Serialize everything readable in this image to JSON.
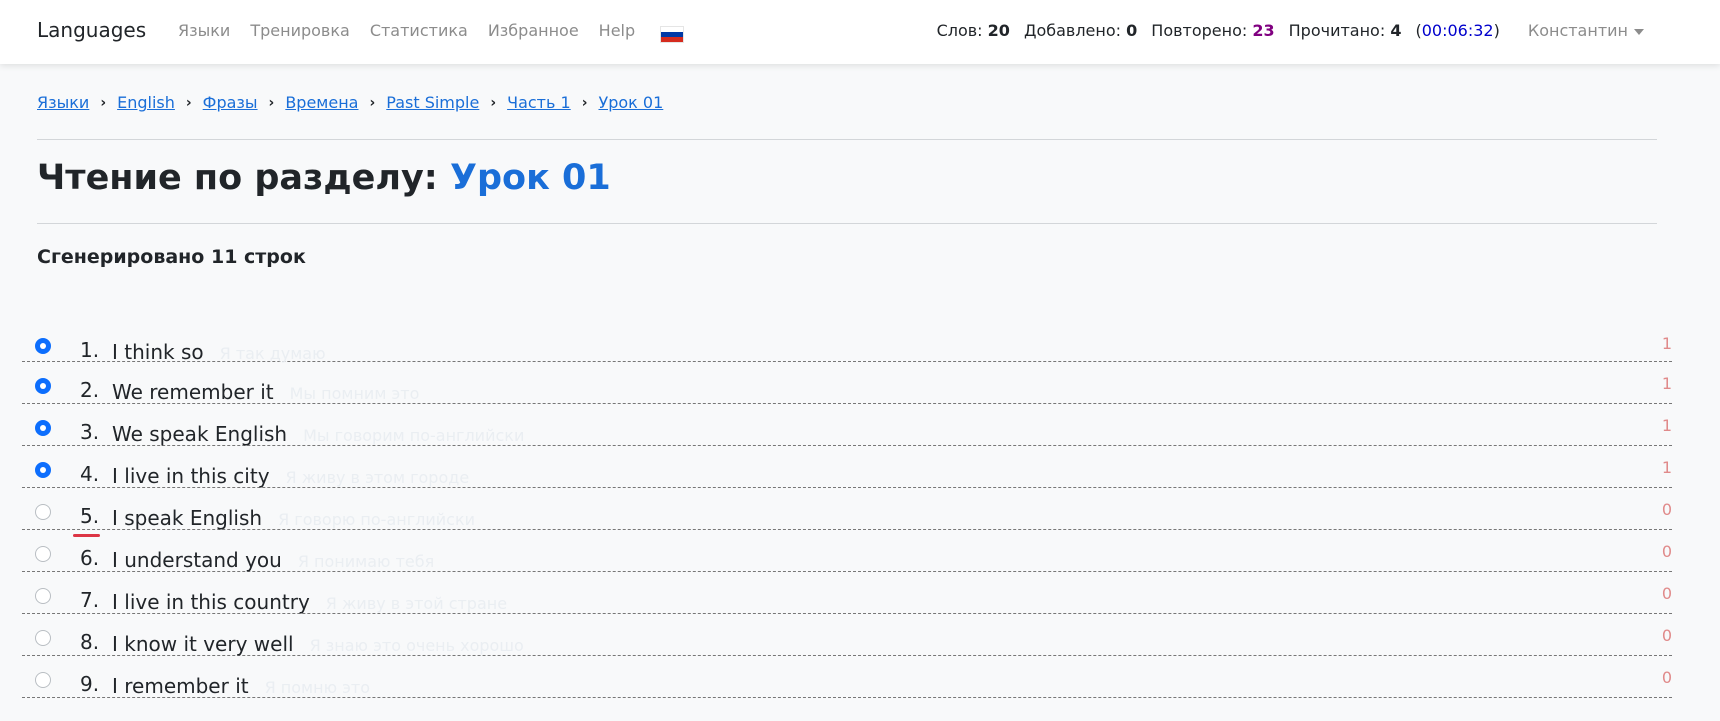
{
  "navbar": {
    "brand": "Languages",
    "links": [
      "Языки",
      "Тренировка",
      "Статистика",
      "Избранное",
      "Help"
    ],
    "flag_colors": [
      "#ffffff",
      "#0039a6",
      "#d52b1e"
    ],
    "stats": {
      "words_label": "Слов:",
      "words_value": "20",
      "added_label": "Добавлено:",
      "added_value": "0",
      "repeated_label": "Повторено:",
      "repeated_value": "23",
      "read_label": "Прочитано:",
      "read_value": "4",
      "timer_open": "(",
      "timer": "00:06:32",
      "timer_close": ")"
    },
    "user": "Константин"
  },
  "breadcrumb": [
    "Языки",
    "English",
    "Фразы",
    "Времена",
    "Past Simple",
    "Часть 1",
    "Урок 01"
  ],
  "heading": {
    "prefix": "Чтение по разделу:",
    "accent": "Урок 01"
  },
  "generated": "Сгенерировано 11 строк",
  "colors": {
    "accent": "#1a6ed8",
    "repeated": "#800080",
    "timer": "#0000cc",
    "count": "#e08a8a",
    "underline": "#dc3545"
  },
  "rows": [
    {
      "num": "1.",
      "en": "I think so",
      "ru": "Я так думаю",
      "count": "1",
      "checked": true
    },
    {
      "num": "2.",
      "en": "We remember it",
      "ru": "Мы помним это",
      "count": "1",
      "checked": true
    },
    {
      "num": "3.",
      "en": "We speak English",
      "ru": "Мы говорим по-английски",
      "count": "1",
      "checked": true
    },
    {
      "num": "4.",
      "en": "I live in this city",
      "ru": "Я живу в этом городе",
      "count": "1",
      "checked": true
    },
    {
      "num": "5.",
      "en": "I speak English",
      "ru": "Я говорю по-английски",
      "count": "0",
      "checked": false,
      "current": true
    },
    {
      "num": "6.",
      "en": "I understand you",
      "ru": "Я понимаю тебя",
      "count": "0",
      "checked": false
    },
    {
      "num": "7.",
      "en": "I live in this country",
      "ru": "Я живу в этой стране",
      "count": "0",
      "checked": false
    },
    {
      "num": "8.",
      "en": "I know it very well",
      "ru": "Я знаю это очень хорошо",
      "count": "0",
      "checked": false
    },
    {
      "num": "9.",
      "en": "I remember it",
      "ru": "Я помню это",
      "count": "0",
      "checked": false
    }
  ]
}
